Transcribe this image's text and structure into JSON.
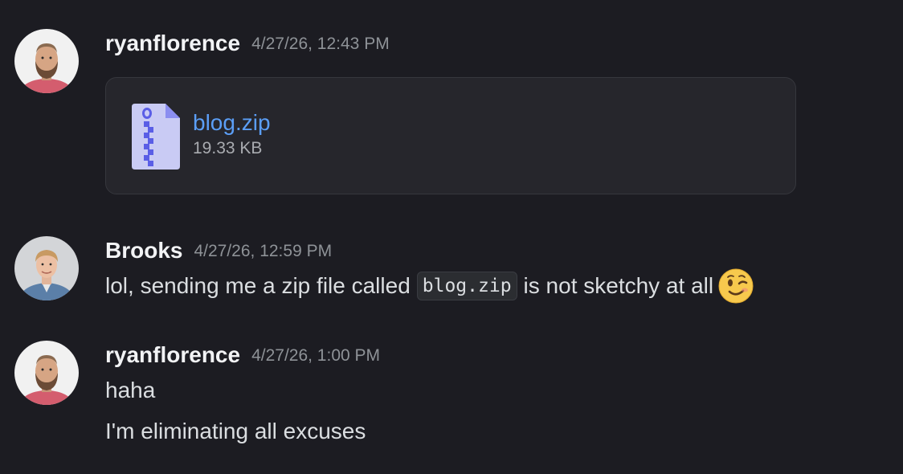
{
  "messages": [
    {
      "author": "ryanflorence",
      "timestamp": "4/27/26, 12:43 PM",
      "attachment": {
        "name": "blog.zip",
        "size": "19.33 KB",
        "icon": "zip-file-icon"
      }
    },
    {
      "author": "Brooks",
      "timestamp": "4/27/26, 12:59 PM",
      "text_before": "lol, sending me a zip file called",
      "code": "blog.zip",
      "text_after": "is not sketchy at all",
      "emoji": "winking-face-emoji"
    },
    {
      "author": "ryanflorence",
      "timestamp": "4/27/26, 1:00 PM",
      "lines": [
        "haha",
        "I'm eliminating all excuses"
      ]
    }
  ],
  "colors": {
    "background": "#1c1c22",
    "link": "#5b9ef6",
    "username": "#f2f3f5",
    "timestamp": "#8e9297"
  }
}
